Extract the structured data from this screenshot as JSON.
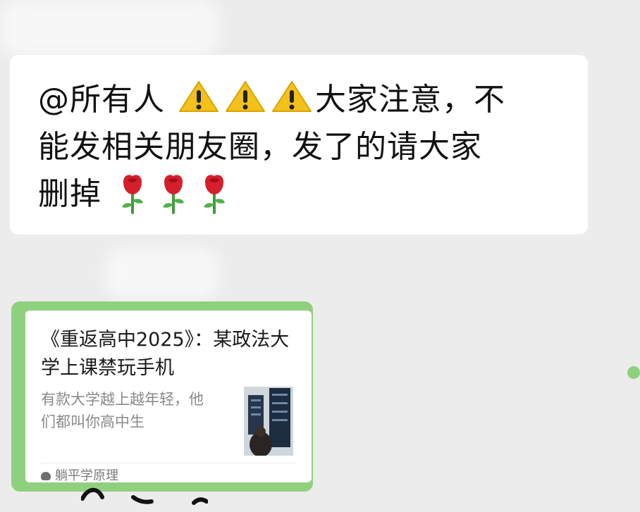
{
  "message": {
    "text_line1_mention": "@所有人",
    "text_line1_after_icons": "大家注意，不",
    "text_line2": "能发相关朋友圈，发了的请大家",
    "text_line3": "删掉",
    "warning_icon": "warning-sign",
    "rose_icon": "rose"
  },
  "share_card": {
    "title": "《重返高中2025》：某政法大学上课禁玩手机",
    "description": "有款大学越上越年轻，他们都叫你高中生",
    "source": "躺平学原理",
    "accent_color": "#8fd07f"
  }
}
